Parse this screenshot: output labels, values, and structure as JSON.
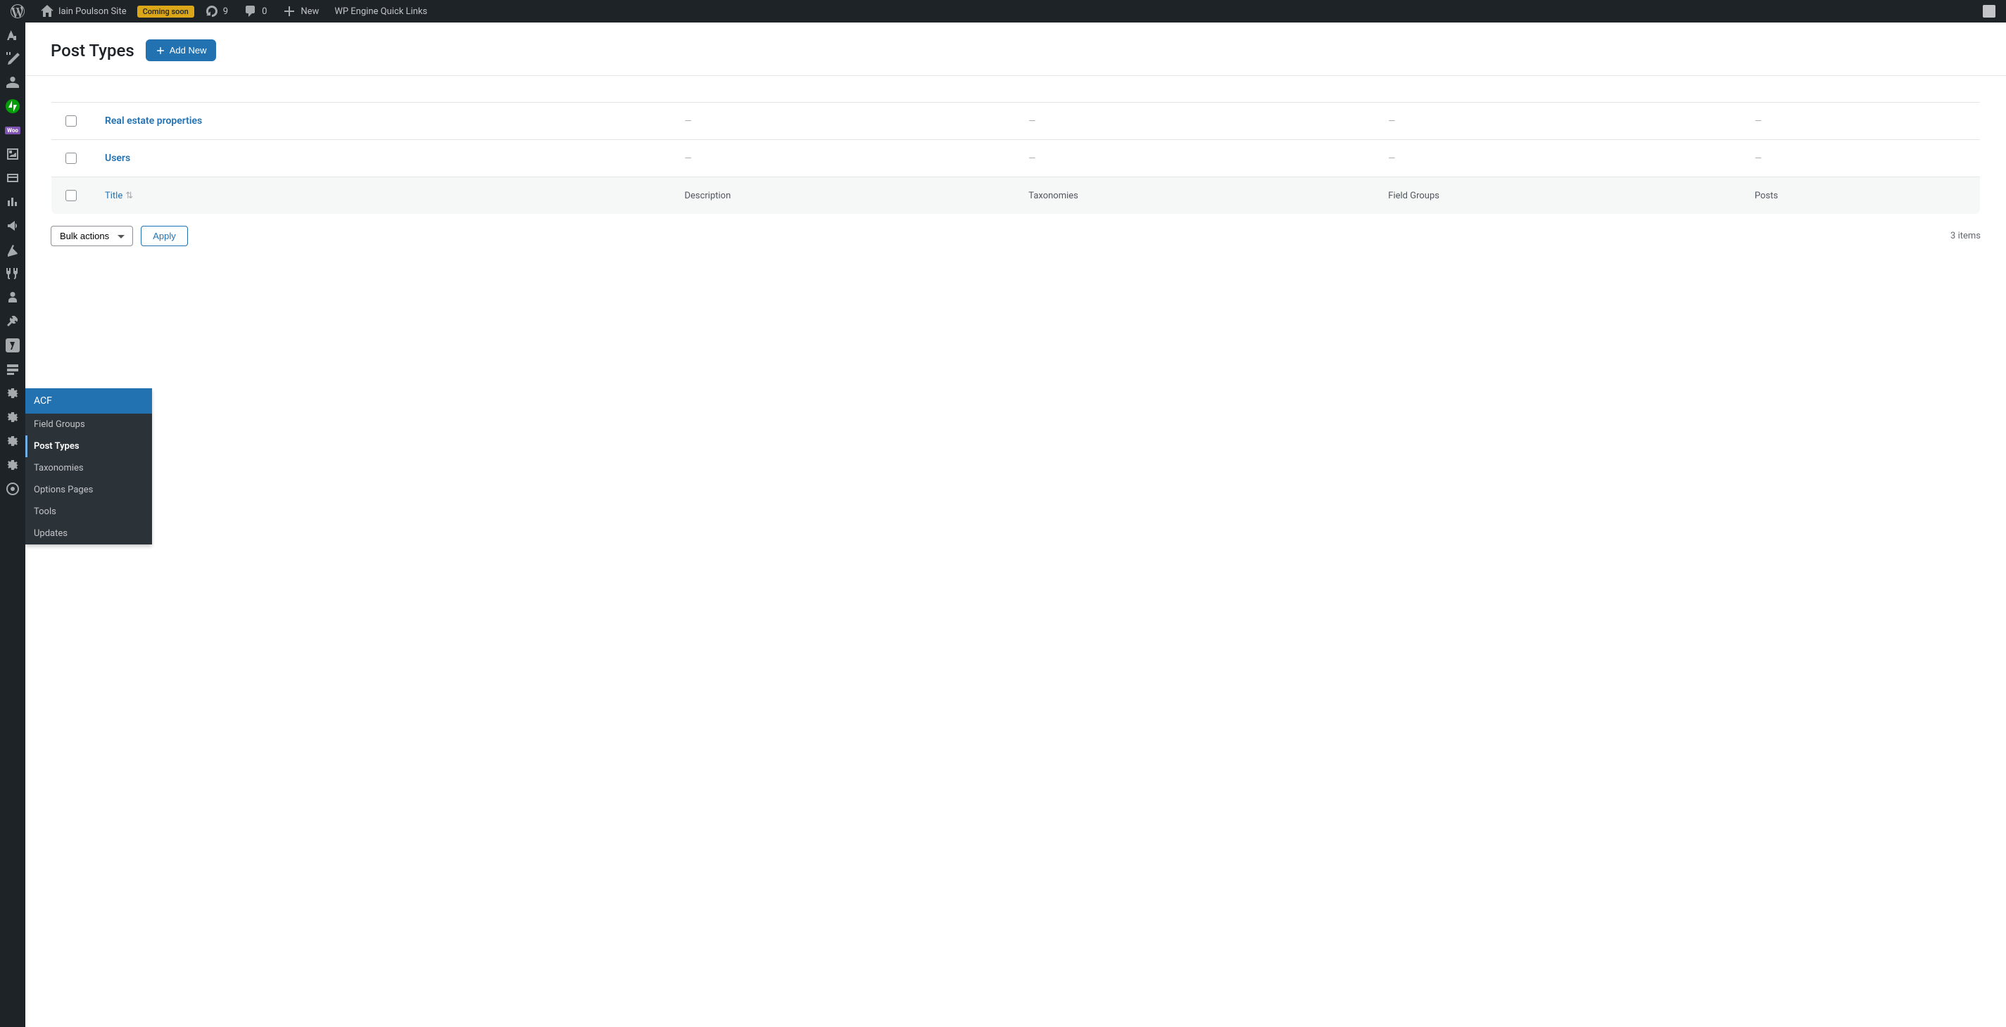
{
  "adminbar": {
    "site_name": "Iain Poulson Site",
    "status_badge": "Coming soon",
    "update_count": "9",
    "comment_count": "0",
    "new_label": "New",
    "quick_links": "WP Engine Quick Links"
  },
  "page": {
    "title": "Post Types",
    "add_new": "Add New"
  },
  "table": {
    "headers": {
      "title": "Title",
      "description": "Description",
      "taxonomies": "Taxonomies",
      "field_groups": "Field Groups",
      "posts": "Posts"
    },
    "rows": [
      {
        "title": "Real estate properties",
        "description": "—",
        "taxonomies": "—",
        "field_groups": "—",
        "posts": "—"
      },
      {
        "title": "Users",
        "description": "—",
        "taxonomies": "—",
        "field_groups": "—",
        "posts": "—"
      }
    ]
  },
  "footer": {
    "bulk_actions": "Bulk actions",
    "apply": "Apply",
    "items_count": "3 items"
  },
  "flyout": {
    "header": "ACF",
    "items": [
      {
        "label": "Field Groups",
        "active": false
      },
      {
        "label": "Post Types",
        "active": true
      },
      {
        "label": "Taxonomies",
        "active": false
      },
      {
        "label": "Options Pages",
        "active": false
      },
      {
        "label": "Tools",
        "active": false
      },
      {
        "label": "Updates",
        "active": false
      }
    ]
  }
}
